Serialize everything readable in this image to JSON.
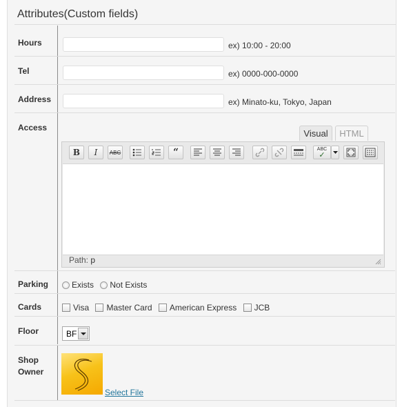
{
  "panel": {
    "title": "Attributes(Custom fields)"
  },
  "fields": {
    "hours": {
      "label": "Hours",
      "value": "",
      "hint": "ex) 10:00 - 20:00"
    },
    "tel": {
      "label": "Tel",
      "value": "",
      "hint": "ex) 0000-000-0000"
    },
    "address": {
      "label": "Address",
      "value": "",
      "hint": "ex) Minato-ku, Tokyo, Japan"
    }
  },
  "access": {
    "label": "Access",
    "tabs": {
      "visual": "Visual",
      "html": "HTML",
      "active": "Visual"
    },
    "toolbar": [
      "bold-icon",
      "italic-icon",
      "strikethrough-icon",
      "bullet-list-icon",
      "numbered-list-icon",
      "blockquote-icon",
      "align-left-icon",
      "align-center-icon",
      "align-right-icon",
      "link-icon",
      "unlink-icon",
      "more-tag-icon",
      "spellcheck-icon",
      "fullscreen-icon",
      "kitchen-sink-icon"
    ],
    "path_label": "Path:",
    "path_value": "p"
  },
  "parking": {
    "label": "Parking",
    "options": [
      "Exists",
      "Not Exists"
    ]
  },
  "cards": {
    "label": "Cards",
    "options": [
      "Visa",
      "Master Card",
      "American Express",
      "JCB"
    ]
  },
  "floor": {
    "label": "Floor",
    "selected": "BF"
  },
  "shop_owner": {
    "label_line1": "Shop",
    "label_line2": "Owner",
    "select_file": "Select File"
  },
  "colors": {
    "link": "#21759b",
    "panel_bg": "#f5f5f5",
    "separator": "#dcdcdc"
  }
}
